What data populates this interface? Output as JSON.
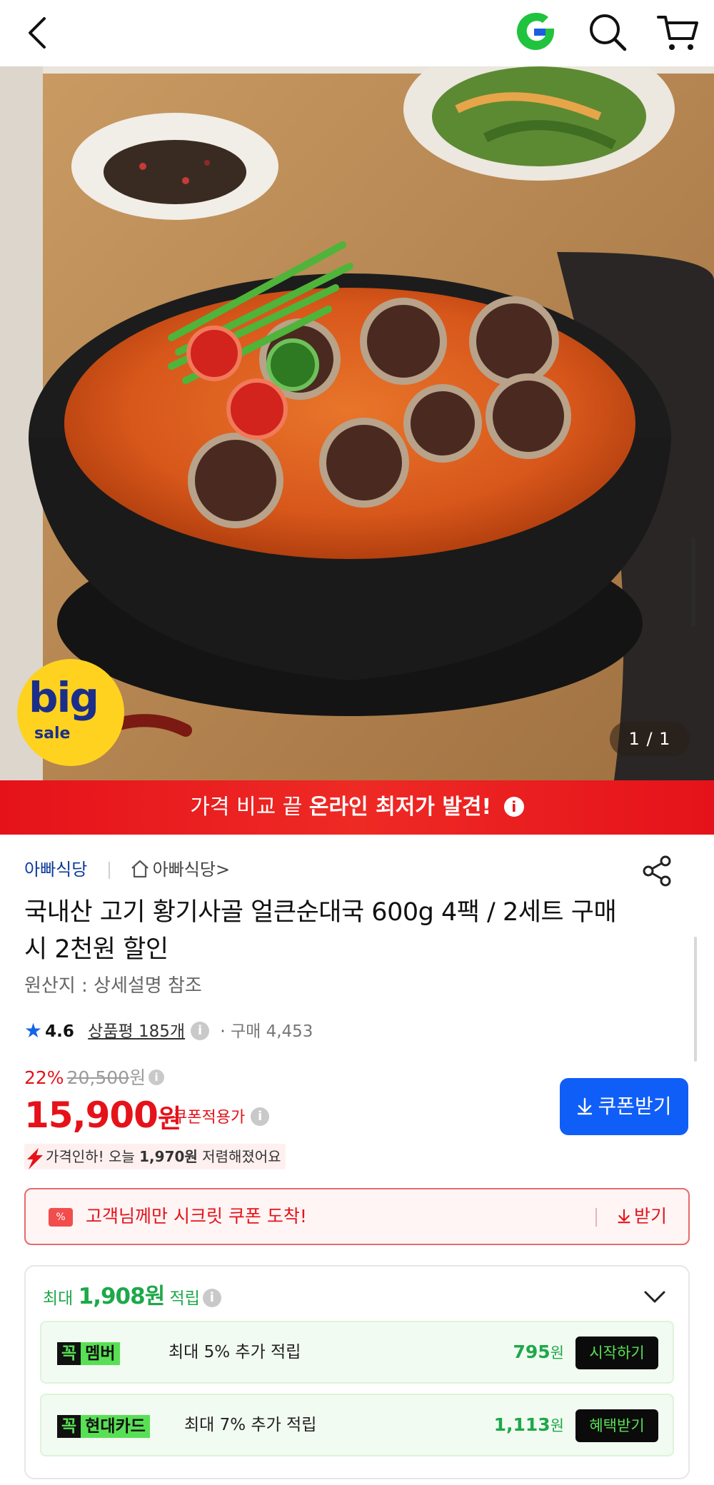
{
  "header": {
    "back_icon": "chevron-left-icon",
    "logo_icon": "g-logo",
    "search_icon": "search-icon",
    "cart_icon": "cart-icon"
  },
  "hero": {
    "image_counter": "1 / 1",
    "badge_big": "big",
    "badge_sale": "sale"
  },
  "banner": {
    "prefix": "가격 비교 끝 ",
    "emphasis": "온라인 최저가 발견!",
    "info": "i"
  },
  "seller": {
    "name": "아빠식당",
    "store_label": "아빠식당",
    "store_chevron": ">"
  },
  "product": {
    "title": "국내산 고기 황기사골 얼큰순대국 600g 4팩 / 2세트 구매 시 2천원 할인",
    "origin": "원산지 : 상세설명 참조",
    "rating": "4.6",
    "reviews": "상품평 185개",
    "purchase_count": "구매 4,453"
  },
  "price": {
    "discount_pct": "22%",
    "original": "20,500",
    "original_unit": "원",
    "final": "15,900",
    "final_unit": "원",
    "coupon_note": "쿠폰적용가",
    "coupon_button": "쿠폰받기",
    "drop_prefix": "가격인하! 오늘 ",
    "drop_amount": "1,970원",
    "drop_suffix": " 저렴해졌어요"
  },
  "secret_coupon": {
    "tag": "%",
    "text": "고객님께만 시크릿 쿠폰 도착!",
    "action": "받기"
  },
  "rewards": {
    "head_prefix": "최대 ",
    "head_amount": "1,908원",
    "head_suffix": " 적립",
    "items": [
      {
        "logo_k": "꼭",
        "logo_n": "멤버",
        "desc": "최대 5% 추가 적립",
        "amount": "795",
        "unit": "원",
        "action": "시작하기"
      },
      {
        "logo_k": "꼭",
        "logo_n": "현대카드",
        "desc": "최대 7% 추가 적립",
        "amount": "1,113",
        "unit": "원",
        "action": "혜택받기"
      }
    ]
  },
  "colors": {
    "accent_red": "#e5121a",
    "accent_blue": "#0f5ef7",
    "reward_green": "#1ea84a",
    "seller_blue": "#0b3a9c"
  }
}
